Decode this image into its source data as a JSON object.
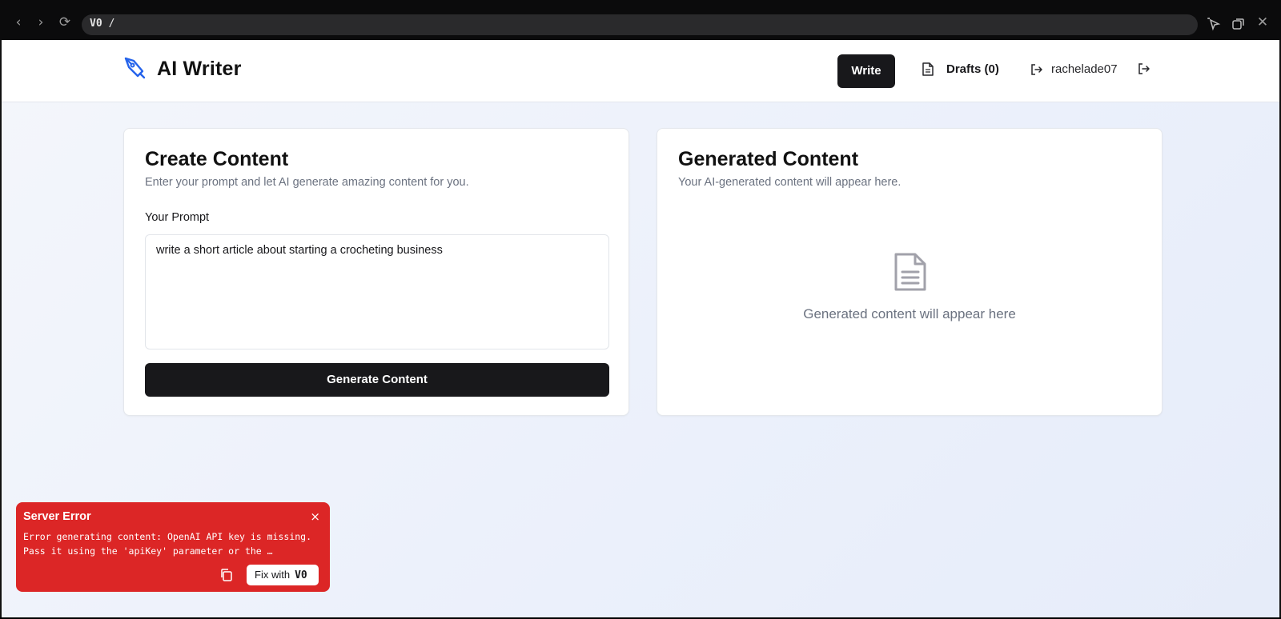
{
  "browser": {
    "url_logo": "V0",
    "url_path": "/",
    "back_glyph": "‹",
    "forward_glyph": "›",
    "reload_glyph": "⟳",
    "close_glyph": "✕"
  },
  "app": {
    "name": "AI Writer",
    "nav": {
      "write_label": "Write",
      "drafts_label": "Drafts (0)",
      "username": "rachelade07"
    }
  },
  "create": {
    "title": "Create Content",
    "description": "Enter your prompt and let AI generate amazing content for you.",
    "prompt_label": "Your Prompt",
    "prompt_value": "write a short article about starting a crocheting business",
    "generate_label": "Generate Content"
  },
  "generated": {
    "title": "Generated Content",
    "description": "Your AI-generated content will appear here.",
    "empty_text": "Generated content will appear here"
  },
  "error_toast": {
    "title": "Server Error",
    "close_glyph": "×",
    "message": "Error generating content: OpenAI API key is missing. Pass it using the 'apiKey' parameter or the …",
    "fix_label": "Fix with",
    "fix_logo": "V0"
  },
  "colors": {
    "brand_icon": "#2563eb",
    "primary_button": "#18181b",
    "error": "#dc2626"
  },
  "icons": [
    "pen-tool-icon",
    "document-icon",
    "login-icon",
    "logout-icon",
    "copy-icon"
  ]
}
